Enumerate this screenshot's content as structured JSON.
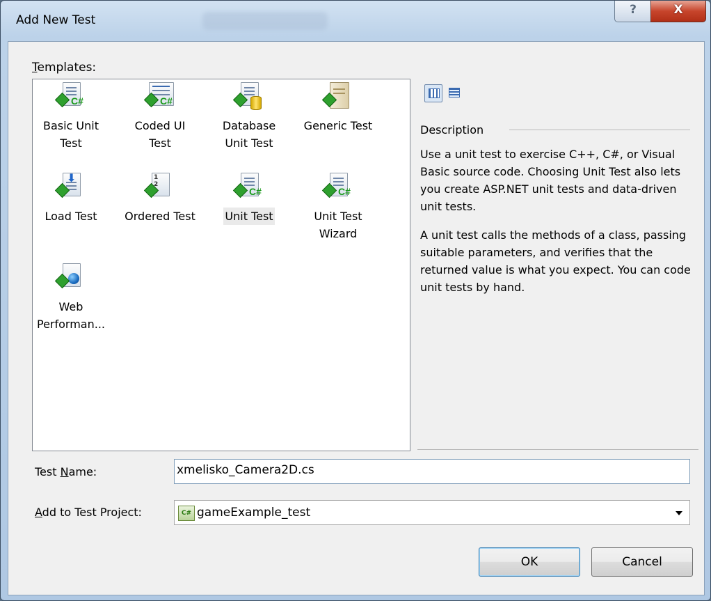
{
  "window": {
    "title": "Add New Test",
    "help_symbol": "?",
    "close_symbol": "X"
  },
  "templates": {
    "label_accel": "T",
    "label_rest": "emplates:",
    "items": [
      {
        "label": "Basic Unit Test",
        "icon": "unit-test-cs-icon"
      },
      {
        "label": "Coded UI Test",
        "icon": "coded-ui-test-icon"
      },
      {
        "label": "Database Unit Test",
        "icon": "database-unit-test-icon"
      },
      {
        "label": "Generic Test",
        "icon": "generic-test-icon"
      },
      {
        "label": "Load Test",
        "icon": "load-test-icon"
      },
      {
        "label": "Ordered Test",
        "icon": "ordered-test-icon"
      },
      {
        "label": "Unit Test",
        "icon": "unit-test-icon",
        "selected": true
      },
      {
        "label": "Unit Test Wizard",
        "icon": "unit-test-wizard-icon"
      },
      {
        "label": "Web Performan...",
        "icon": "web-performance-test-icon"
      }
    ],
    "ordered_icon_nums": "1\n2\n3"
  },
  "view_buttons": {
    "large": "large-icons-view-icon",
    "small": "small-icons-view-icon"
  },
  "description": {
    "heading": "Description",
    "paragraphs": [
      "Use a unit test to exercise C++, C#, or Visual Basic source code. Choosing Unit Test also lets you create ASP.NET unit tests and data-driven unit tests.",
      "A unit test calls the methods of a class, passing suitable parameters, and verifies that the returned value is what you expect. You can code unit tests by hand."
    ]
  },
  "test_name": {
    "label_pre": "Test ",
    "label_accel": "N",
    "label_post": "ame:",
    "value": "xmelisko_Camera2D.cs"
  },
  "test_project": {
    "label_pre": "",
    "label_accel": "A",
    "label_post": "dd to Test Project:",
    "value": "gameExample_test",
    "icon_text": "C#"
  },
  "buttons": {
    "ok": "OK",
    "cancel": "Cancel"
  }
}
